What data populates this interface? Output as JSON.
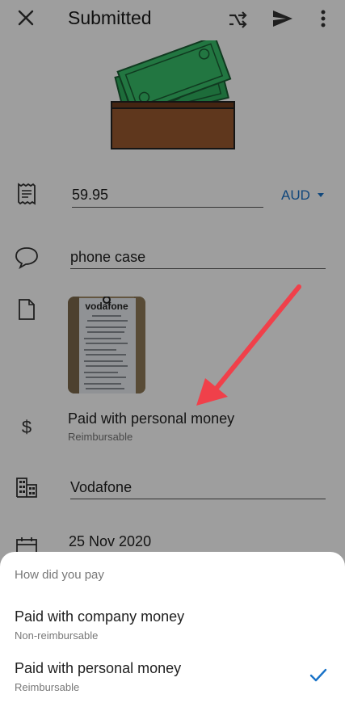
{
  "header": {
    "title": "Submitted",
    "close_icon": "close-icon",
    "share_icon": "share-icon",
    "send_icon": "send-icon",
    "more_icon": "more-vert-icon"
  },
  "amount": {
    "value": "59.95",
    "currency": "AUD"
  },
  "description": {
    "value": "phone case"
  },
  "receipt": {
    "brand_text": "vodafone"
  },
  "payment": {
    "label": "Paid with personal money",
    "sub": "Reimbursable"
  },
  "merchant": {
    "value": "Vodafone"
  },
  "date": {
    "value": "25 Nov 2020"
  },
  "sheet": {
    "title": "How did you pay",
    "options": [
      {
        "label": "Paid with company money",
        "sub": "Non-reimbursable",
        "selected": false
      },
      {
        "label": "Paid with personal money",
        "sub": "Reimbursable",
        "selected": true
      }
    ]
  },
  "colors": {
    "accent": "#1a73c8",
    "annotation_arrow": "#f0404a",
    "money_green": "#2fae5e",
    "wallet_brown": "#9a5a30"
  }
}
